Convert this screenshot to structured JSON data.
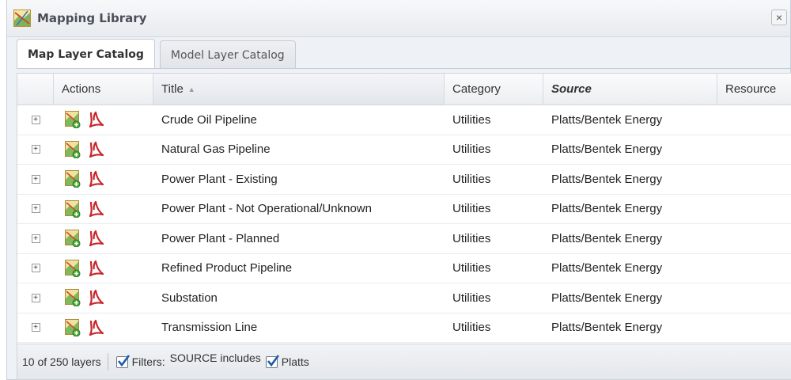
{
  "window": {
    "title": "Mapping Library",
    "close_glyph": "×",
    "icon": "map-layer-icon"
  },
  "tabs": [
    {
      "label": "Map Layer Catalog",
      "active": true
    },
    {
      "label": "Model Layer Catalog",
      "active": false
    }
  ],
  "grid": {
    "columns": {
      "actions": "Actions",
      "title": "Title",
      "category": "Category",
      "source": "Source",
      "resource": "Resource"
    },
    "sort": {
      "column": "title",
      "direction": "ascending"
    },
    "rows": [
      {
        "title": "Crude Oil Pipeline",
        "category": "Utilities",
        "source": "Platts/Bentek Energy",
        "resource": ""
      },
      {
        "title": "Natural Gas Pipeline",
        "category": "Utilities",
        "source": "Platts/Bentek Energy",
        "resource": ""
      },
      {
        "title": "Power Plant - Existing",
        "category": "Utilities",
        "source": "Platts/Bentek Energy",
        "resource": ""
      },
      {
        "title": "Power Plant - Not Operational/Unknown",
        "category": "Utilities",
        "source": "Platts/Bentek Energy",
        "resource": ""
      },
      {
        "title": "Power Plant - Planned",
        "category": "Utilities",
        "source": "Platts/Bentek Energy",
        "resource": ""
      },
      {
        "title": "Refined Product Pipeline",
        "category": "Utilities",
        "source": "Platts/Bentek Energy",
        "resource": ""
      },
      {
        "title": "Substation",
        "category": "Utilities",
        "source": "Platts/Bentek Energy",
        "resource": ""
      },
      {
        "title": "Transmission Line",
        "category": "Utilities",
        "source": "Platts/Bentek Energy",
        "resource": ""
      }
    ],
    "row_icons": [
      "add-to-map-icon",
      "pdf-icon"
    ],
    "expander_glyph": "+"
  },
  "footer": {
    "count": "10 of 250 layers",
    "filters_label": "Filters:",
    "filter_text": "SOURCE includes",
    "filter_value": "Platts",
    "filters_checked": true,
    "value_checked": true
  },
  "colors": {
    "pdf_red": "#c8262b",
    "map_green": "#5aa63a",
    "check_blue": "#1e5aa8"
  }
}
